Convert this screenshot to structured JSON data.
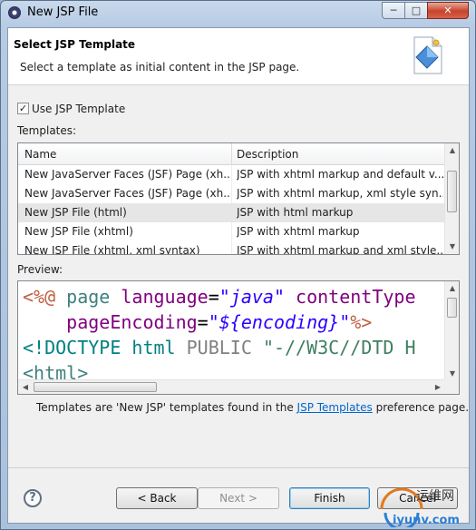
{
  "window": {
    "title": "New JSP File",
    "min_glyph": "─",
    "max_glyph": "□",
    "close_glyph": "✕"
  },
  "header": {
    "title": "Select JSP Template",
    "description": "Select a template as initial content in the JSP page."
  },
  "use_template": {
    "label": "Use JSP Template",
    "checked": true,
    "check_glyph": "✓"
  },
  "templates": {
    "label": "Templates:",
    "columns": [
      "Name",
      "Description"
    ],
    "rows": [
      {
        "name": "New JavaServer Faces (JSF) Page (xh...",
        "description": "JSP with xhtml markup and default v..."
      },
      {
        "name": "New JavaServer Faces (JSF) Page (xh...",
        "description": "JSP with xhtml markup, xml style syn..."
      },
      {
        "name": "New JSP File (html)",
        "description": "JSP with html markup"
      },
      {
        "name": "New JSP File (xhtml)",
        "description": "JSP with xhtml markup"
      },
      {
        "name": "New JSP File (xhtml, xml syntax)",
        "description": "JSP with xhtml markup and xml style..."
      }
    ],
    "selected_index": 2
  },
  "preview": {
    "label": "Preview:",
    "lines": [
      [
        {
          "t": "<%@",
          "c": "c-jsp"
        },
        {
          "t": " page ",
          "c": "c-tag"
        },
        {
          "t": "language",
          "c": "c-attr"
        },
        {
          "t": "=",
          "c": "c-eq"
        },
        {
          "t": "\"java\"",
          "c": "c-val"
        },
        {
          "t": " contentType",
          "c": "c-attr"
        }
      ],
      [
        {
          "t": "    pageEncoding",
          "c": "c-attr"
        },
        {
          "t": "=",
          "c": "c-eq"
        },
        {
          "t": "\"${encoding}\"",
          "c": "c-val"
        },
        {
          "t": "%>",
          "c": "c-jsp"
        }
      ],
      [
        {
          "t": "<!DOCTYPE ",
          "c": "c-doctype"
        },
        {
          "t": "html ",
          "c": "c-doctype"
        },
        {
          "t": "PUBLIC ",
          "c": "c-grey"
        },
        {
          "t": "\"-//W3C//DTD H",
          "c": "c-str"
        }
      ],
      [
        {
          "t": "<html>",
          "c": "c-tag"
        }
      ]
    ]
  },
  "footer_note": {
    "before": "Templates are 'New JSP' templates found in the ",
    "link": "JSP Templates",
    "after": " preference page."
  },
  "buttons": {
    "help": "?",
    "back": "< Back",
    "next": "Next >",
    "finish": "Finish",
    "cancel": "Cancel"
  },
  "watermark": {
    "line1": "运维网",
    "line2": "iyunv.com"
  }
}
